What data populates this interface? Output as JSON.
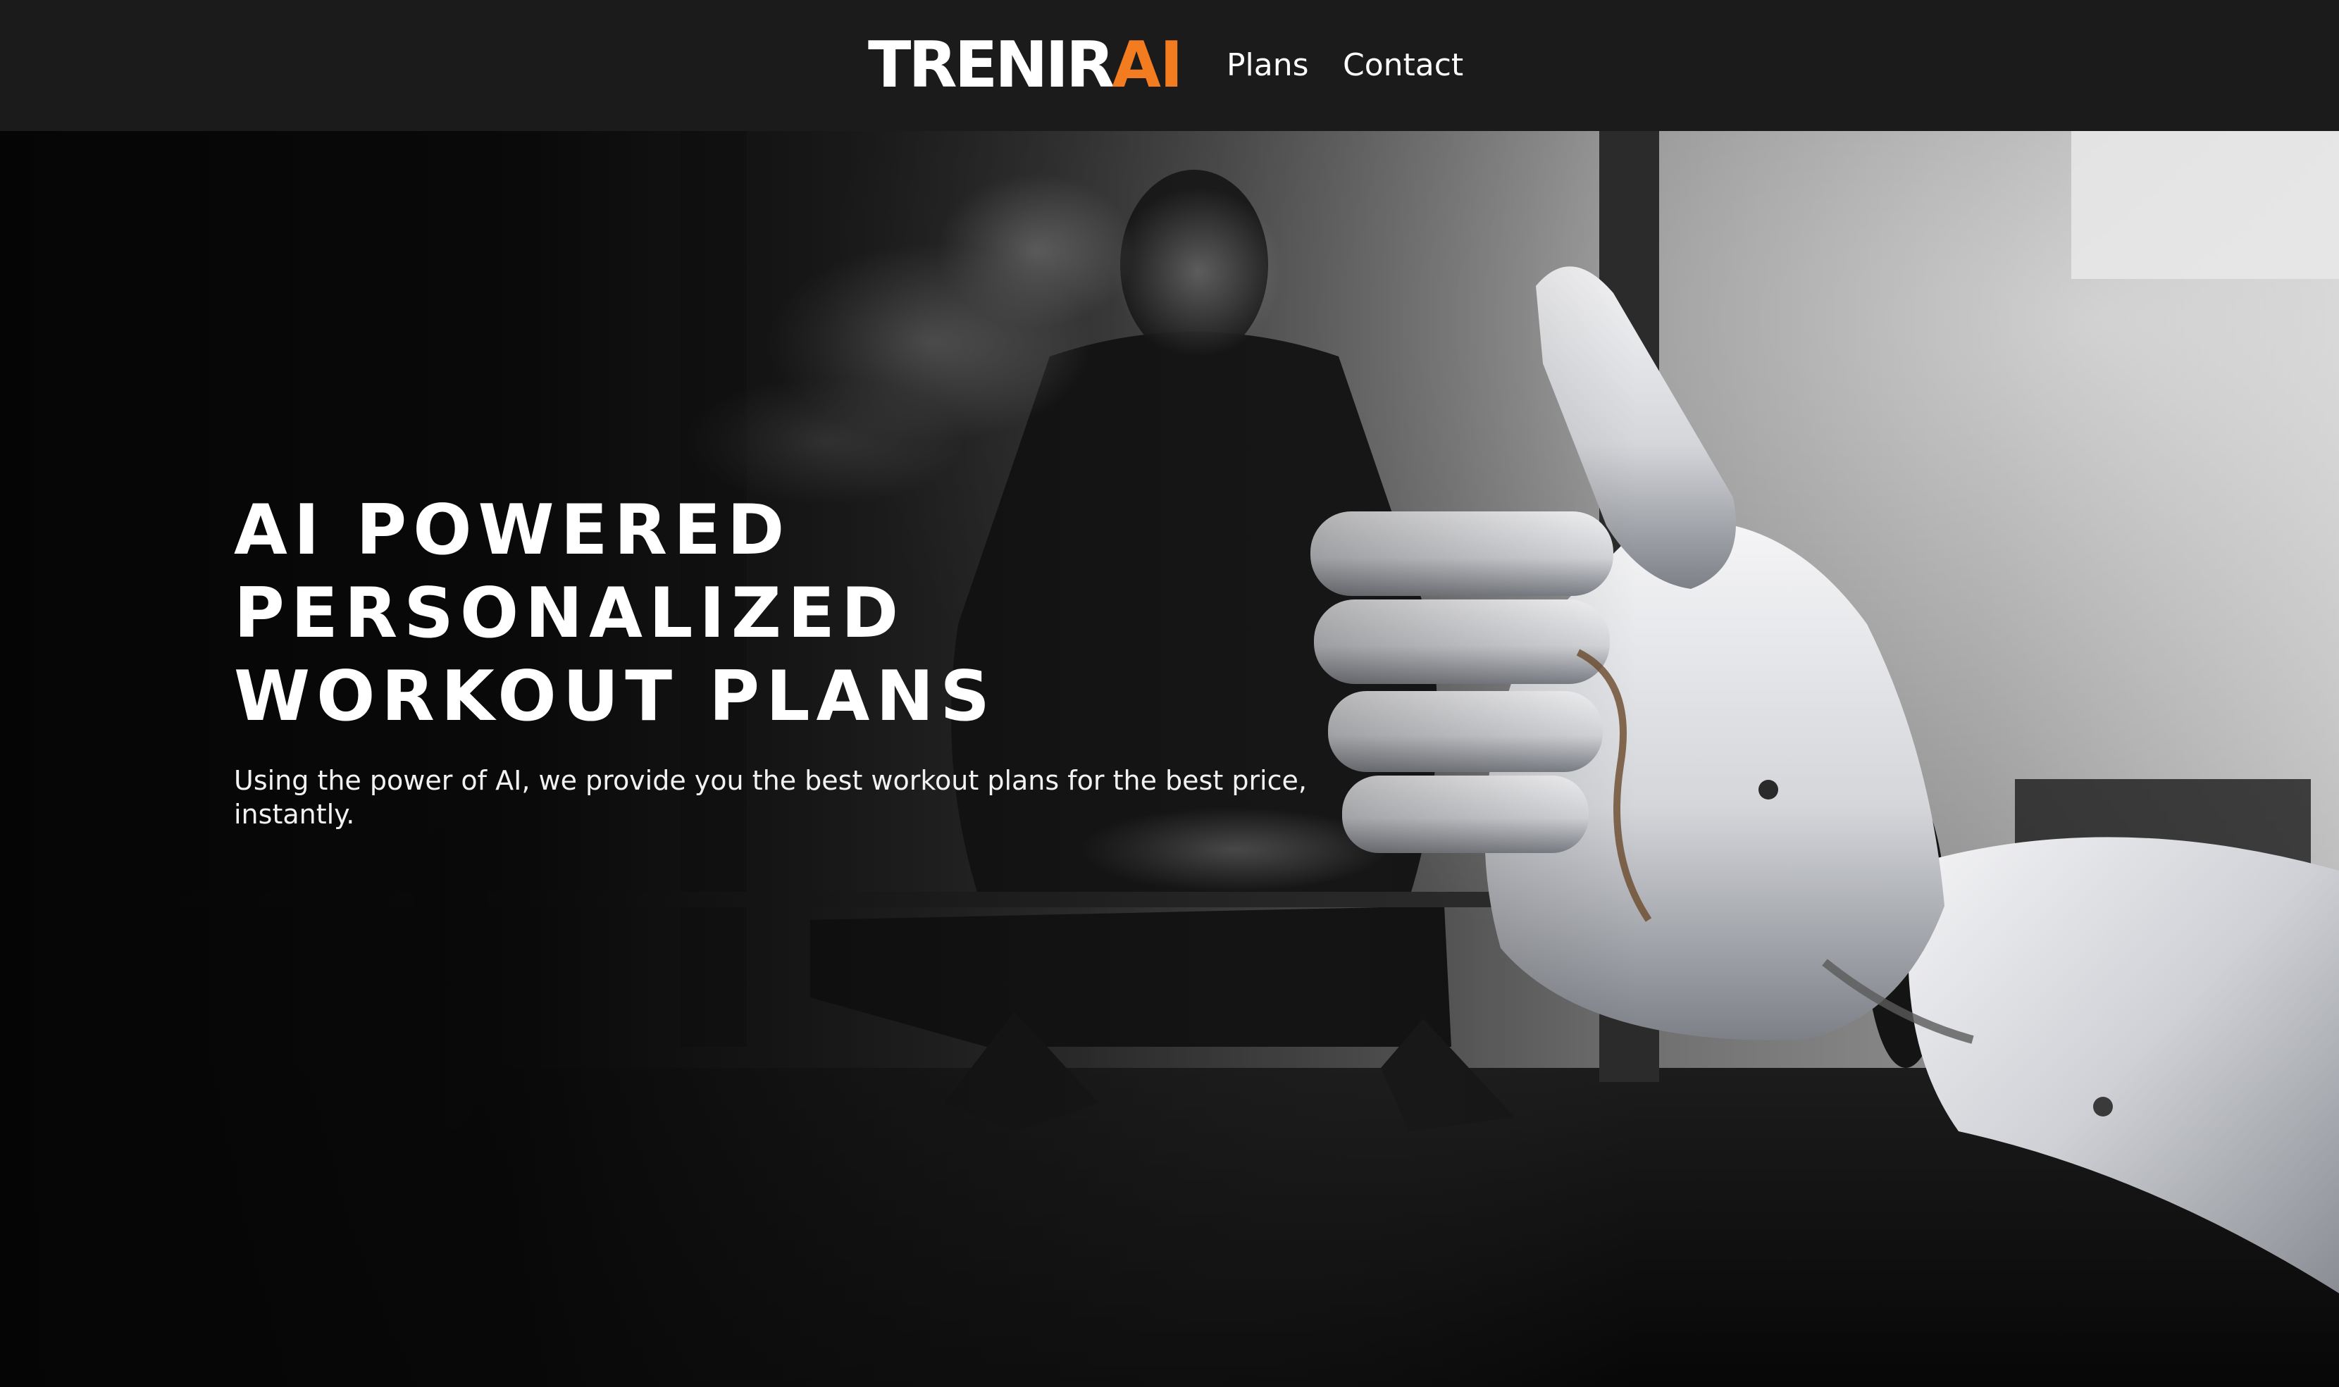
{
  "brand": {
    "name_main": "TRENIR",
    "name_accent": "AI",
    "accent_color": "#f47c20"
  },
  "nav": {
    "items": [
      {
        "label": "Plans"
      },
      {
        "label": "Contact"
      }
    ]
  },
  "hero": {
    "heading_lines": [
      "AI POWERED",
      "PERSONALIZED",
      "WORKOUT PLANS"
    ],
    "subtitle": "Using the power of AI, we provide you the best workout plans for the best price, instantly.",
    "background_icon": "gym-athlete-robot-hand-thumbs-up-image"
  },
  "colors": {
    "navbar_bg": "#1b1b1b",
    "text": "#ffffff"
  }
}
